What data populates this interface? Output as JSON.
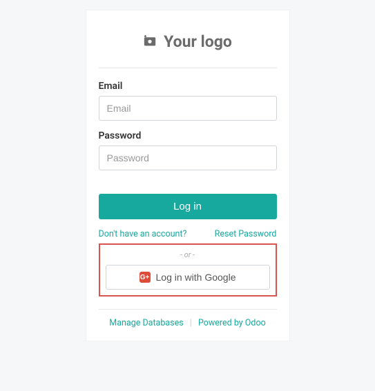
{
  "logo": {
    "text": "Your logo",
    "icon_name": "add-photo-icon"
  },
  "form": {
    "email_label": "Email",
    "email_placeholder": "Email",
    "password_label": "Password",
    "password_placeholder": "Password",
    "login_button": "Log in",
    "signup_link": "Don't have an account?",
    "reset_link": "Reset Password",
    "or_text": "- or -",
    "google_button": "Log in with Google"
  },
  "footer": {
    "manage_db": "Manage Databases",
    "powered_by": "Powered by Odoo"
  },
  "colors": {
    "accent": "#17a89e",
    "highlight_border": "#d9534f"
  }
}
